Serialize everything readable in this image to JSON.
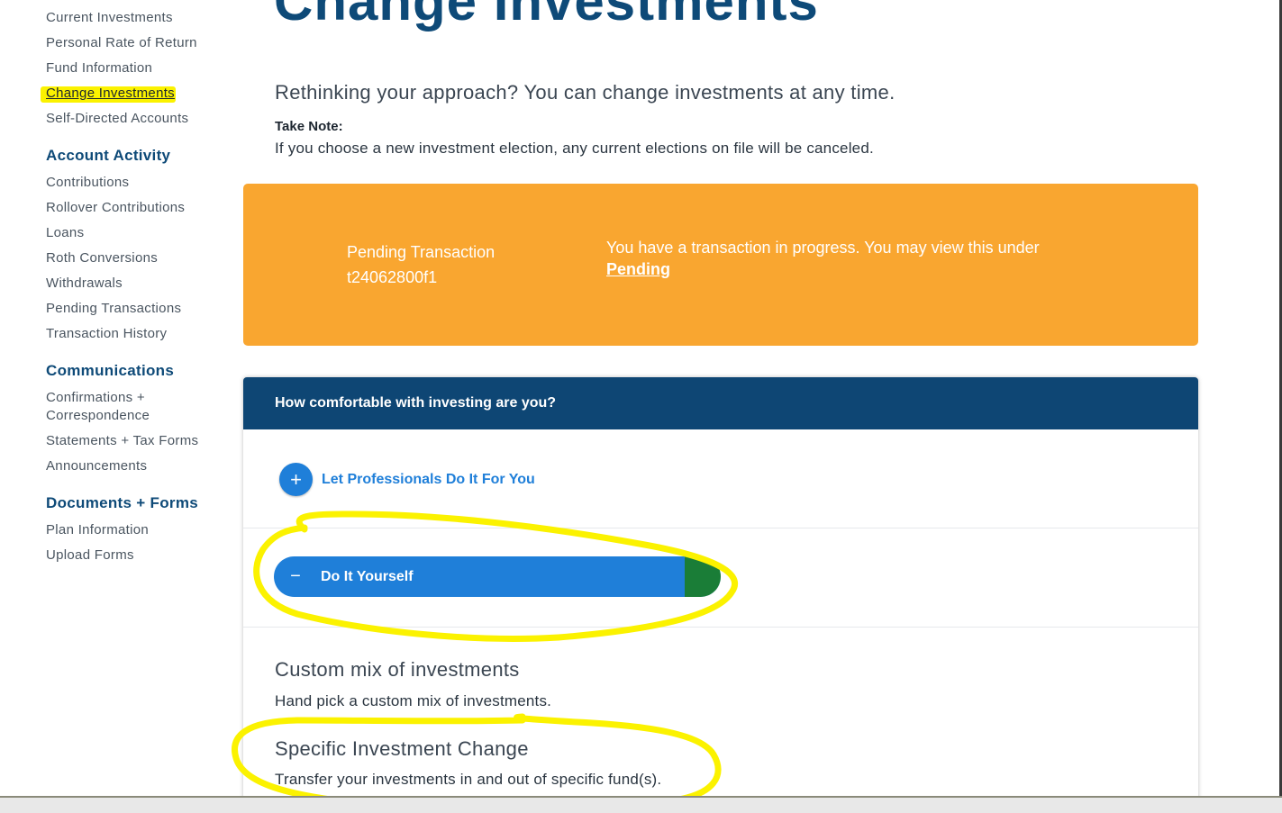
{
  "sidebar": {
    "investments_links": [
      "Current Investments",
      "Personal Rate of Return",
      "Fund Information",
      "Change Investments",
      "Self-Directed Accounts"
    ],
    "account_activity": {
      "heading": "Account Activity",
      "links": [
        "Contributions",
        "Rollover Contributions",
        "Loans",
        "Roth Conversions",
        "Withdrawals",
        "Pending Transactions",
        "Transaction History"
      ]
    },
    "communications": {
      "heading": "Communications",
      "links": [
        "Confirmations + Correspondence",
        "Statements + Tax Forms",
        "Announcements"
      ]
    },
    "documents_forms": {
      "heading": "Documents + Forms",
      "links": [
        "Plan Information",
        "Upload Forms"
      ]
    }
  },
  "main": {
    "title": "Change Investments",
    "subtitle": "Rethinking your approach? You can change investments at any time.",
    "note_label": "Take Note:",
    "note_text": "If you choose a new investment election, any current elections on file will be canceled."
  },
  "alert": {
    "title_line1": "Pending Transaction",
    "title_line2": "t24062800f1",
    "message": "You have a transaction in progress. You may view this under",
    "link": "Pending"
  },
  "panel": {
    "heading": "How comfortable with investing are you?",
    "professional_option": "Let Professionals Do It For You",
    "diy_option": "Do It Yourself",
    "plus_icon": "+",
    "minus_icon": "−",
    "choices": [
      {
        "title": "Custom mix of investments",
        "desc": "Hand pick a custom mix of investments."
      },
      {
        "title": "Specific Investment Change",
        "desc": "Transfer your investments in and out of specific fund(s)."
      }
    ]
  },
  "colors": {
    "brand_navy": "#0e4a78",
    "accent_blue": "#1f7fd9",
    "alert_orange": "#f9a630",
    "highlight_yellow": "#fbf200"
  }
}
